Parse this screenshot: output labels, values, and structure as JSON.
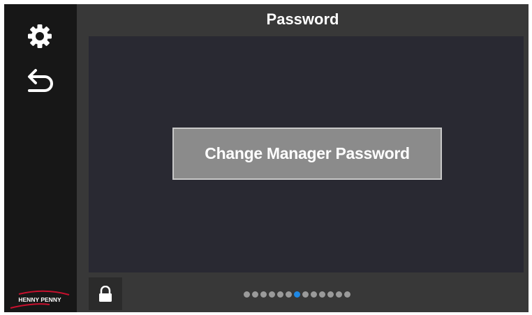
{
  "header": {
    "title": "Password"
  },
  "main": {
    "change_manager_password_label": "Change Manager Password"
  },
  "sidebar": {
    "settings_icon": "gear-icon",
    "back_icon": "undo-arrow-icon",
    "brand_logo_text": "HENNY PENNY"
  },
  "footer": {
    "lock_icon": "lock-icon",
    "page_indicator": {
      "total": 13,
      "active": 7
    }
  },
  "colors": {
    "accent": "#1e88e5",
    "sidebar_bg": "#171717",
    "main_bg": "#383838",
    "content_bg": "#292932",
    "button_bg": "#8b8b8b",
    "logo_red": "#c8102e"
  }
}
